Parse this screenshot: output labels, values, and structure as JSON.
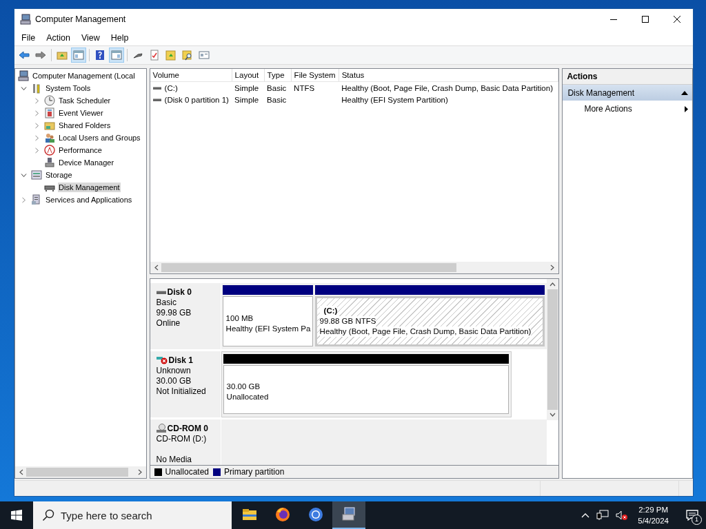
{
  "window": {
    "title": "Computer Management"
  },
  "menu": [
    "File",
    "Action",
    "View",
    "Help"
  ],
  "toolbar": [
    {
      "kind": "back",
      "pressed": false
    },
    {
      "kind": "forward",
      "pressed": false
    },
    {
      "kind": "sep"
    },
    {
      "kind": "up-folder",
      "pressed": false
    },
    {
      "kind": "console-tree",
      "pressed": true
    },
    {
      "kind": "sep"
    },
    {
      "kind": "help",
      "pressed": false
    },
    {
      "kind": "action-pane",
      "pressed": true
    },
    {
      "kind": "sep"
    },
    {
      "kind": "connect",
      "pressed": false
    },
    {
      "kind": "checklist",
      "pressed": false
    },
    {
      "kind": "folder-arrow",
      "pressed": false
    },
    {
      "kind": "folder-search",
      "pressed": false
    },
    {
      "kind": "panel",
      "pressed": false
    }
  ],
  "tree": [
    {
      "label": "Computer Management (Local",
      "kind": "computer",
      "selected": false,
      "children": [
        {
          "label": "System Tools",
          "kind": "tools",
          "expanded": true,
          "selected": false,
          "children": [
            {
              "label": "Task Scheduler",
              "kind": "clock",
              "expanded": false,
              "selected": false
            },
            {
              "label": "Event Viewer",
              "kind": "log",
              "expanded": false,
              "selected": false
            },
            {
              "label": "Shared Folders",
              "kind": "share",
              "expanded": false,
              "selected": false
            },
            {
              "label": "Local Users and Groups",
              "kind": "users",
              "expanded": false,
              "selected": false
            },
            {
              "label": "Performance",
              "kind": "gauge",
              "expanded": false,
              "selected": false
            },
            {
              "label": "Device Manager",
              "kind": "device",
              "selected": false
            }
          ]
        },
        {
          "label": "Storage",
          "kind": "storage",
          "expanded": true,
          "selected": false,
          "children": [
            {
              "label": "Disk Management",
              "kind": "drive",
              "selected": true
            }
          ]
        },
        {
          "label": "Services and Applications",
          "kind": "services",
          "expanded": false,
          "selected": false
        }
      ]
    }
  ],
  "volumes": {
    "columns": [
      "Volume",
      "Layout",
      "Type",
      "File System",
      "Status"
    ],
    "rows": [
      {
        "cells": [
          "(C:)",
          "Simple",
          "Basic",
          "NTFS",
          "Healthy (Boot, Page File, Crash Dump, Basic Data Partition)"
        ]
      },
      {
        "cells": [
          "(Disk 0 partition 1)",
          "Simple",
          "Basic",
          "",
          "Healthy (EFI System Partition)"
        ]
      }
    ]
  },
  "disks": [
    {
      "kind": "disk",
      "name": "Disk 0",
      "lines": [
        "Basic",
        "99.98 GB",
        "Online"
      ],
      "partitions": [
        {
          "kind": "primary",
          "size": "100 MB",
          "status": "Healthy (EFI System Pa",
          "selected": false
        },
        {
          "kind": "primary",
          "label": "(C:)",
          "size": "99.88 GB NTFS",
          "status": "Healthy (Boot, Page File, Crash Dump, Basic Data Partition)",
          "selected": true
        }
      ]
    },
    {
      "kind": "disk-error",
      "name": "Disk 1",
      "lines": [
        "Unknown",
        "30.00 GB",
        "Not Initialized"
      ],
      "partitions": [
        {
          "kind": "unallocated",
          "size": "30.00 GB",
          "status": "Unallocated",
          "selected": false
        }
      ]
    },
    {
      "kind": "cdrom",
      "name": "CD-ROM 0",
      "lines": [
        "CD-ROM (D:)",
        "No Media"
      ]
    }
  ],
  "legend": [
    {
      "kind": "unallocated",
      "label": "Unallocated",
      "color": "#000000"
    },
    {
      "kind": "primary",
      "label": "Primary partition",
      "color": "#00007f"
    }
  ],
  "actions": {
    "title": "Actions",
    "sections": [
      {
        "label": "Disk Management",
        "expanded": true,
        "items": [
          "More Actions"
        ]
      }
    ]
  },
  "taskbar": {
    "search": {
      "placeholder": "Type here to search"
    },
    "apps": [
      {
        "kind": "explorer",
        "active": false
      },
      {
        "kind": "firefox",
        "active": false
      },
      {
        "kind": "chrome",
        "active": false
      },
      {
        "kind": "computer-management",
        "active": true
      }
    ],
    "time": "2:29 PM",
    "date": "5/4/2024",
    "notifications": "1"
  }
}
